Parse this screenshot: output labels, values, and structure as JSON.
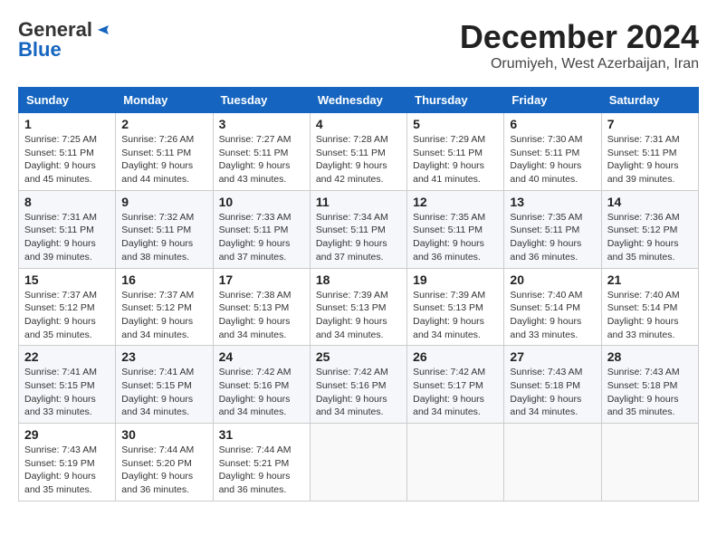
{
  "header": {
    "logo_general": "General",
    "logo_blue": "Blue",
    "title": "December 2024",
    "subtitle": "Orumiyeh, West Azerbaijan, Iran"
  },
  "weekdays": [
    "Sunday",
    "Monday",
    "Tuesday",
    "Wednesday",
    "Thursday",
    "Friday",
    "Saturday"
  ],
  "weeks": [
    [
      {
        "day": 1,
        "sunrise": "7:25 AM",
        "sunset": "5:11 PM",
        "daylight": "9 hours and 45 minutes."
      },
      {
        "day": 2,
        "sunrise": "7:26 AM",
        "sunset": "5:11 PM",
        "daylight": "9 hours and 44 minutes."
      },
      {
        "day": 3,
        "sunrise": "7:27 AM",
        "sunset": "5:11 PM",
        "daylight": "9 hours and 43 minutes."
      },
      {
        "day": 4,
        "sunrise": "7:28 AM",
        "sunset": "5:11 PM",
        "daylight": "9 hours and 42 minutes."
      },
      {
        "day": 5,
        "sunrise": "7:29 AM",
        "sunset": "5:11 PM",
        "daylight": "9 hours and 41 minutes."
      },
      {
        "day": 6,
        "sunrise": "7:30 AM",
        "sunset": "5:11 PM",
        "daylight": "9 hours and 40 minutes."
      },
      {
        "day": 7,
        "sunrise": "7:31 AM",
        "sunset": "5:11 PM",
        "daylight": "9 hours and 39 minutes."
      }
    ],
    [
      {
        "day": 8,
        "sunrise": "7:31 AM",
        "sunset": "5:11 PM",
        "daylight": "9 hours and 39 minutes."
      },
      {
        "day": 9,
        "sunrise": "7:32 AM",
        "sunset": "5:11 PM",
        "daylight": "9 hours and 38 minutes."
      },
      {
        "day": 10,
        "sunrise": "7:33 AM",
        "sunset": "5:11 PM",
        "daylight": "9 hours and 37 minutes."
      },
      {
        "day": 11,
        "sunrise": "7:34 AM",
        "sunset": "5:11 PM",
        "daylight": "9 hours and 37 minutes."
      },
      {
        "day": 12,
        "sunrise": "7:35 AM",
        "sunset": "5:11 PM",
        "daylight": "9 hours and 36 minutes."
      },
      {
        "day": 13,
        "sunrise": "7:35 AM",
        "sunset": "5:11 PM",
        "daylight": "9 hours and 36 minutes."
      },
      {
        "day": 14,
        "sunrise": "7:36 AM",
        "sunset": "5:12 PM",
        "daylight": "9 hours and 35 minutes."
      }
    ],
    [
      {
        "day": 15,
        "sunrise": "7:37 AM",
        "sunset": "5:12 PM",
        "daylight": "9 hours and 35 minutes."
      },
      {
        "day": 16,
        "sunrise": "7:37 AM",
        "sunset": "5:12 PM",
        "daylight": "9 hours and 34 minutes."
      },
      {
        "day": 17,
        "sunrise": "7:38 AM",
        "sunset": "5:13 PM",
        "daylight": "9 hours and 34 minutes."
      },
      {
        "day": 18,
        "sunrise": "7:39 AM",
        "sunset": "5:13 PM",
        "daylight": "9 hours and 34 minutes."
      },
      {
        "day": 19,
        "sunrise": "7:39 AM",
        "sunset": "5:13 PM",
        "daylight": "9 hours and 34 minutes."
      },
      {
        "day": 20,
        "sunrise": "7:40 AM",
        "sunset": "5:14 PM",
        "daylight": "9 hours and 33 minutes."
      },
      {
        "day": 21,
        "sunrise": "7:40 AM",
        "sunset": "5:14 PM",
        "daylight": "9 hours and 33 minutes."
      }
    ],
    [
      {
        "day": 22,
        "sunrise": "7:41 AM",
        "sunset": "5:15 PM",
        "daylight": "9 hours and 33 minutes."
      },
      {
        "day": 23,
        "sunrise": "7:41 AM",
        "sunset": "5:15 PM",
        "daylight": "9 hours and 34 minutes."
      },
      {
        "day": 24,
        "sunrise": "7:42 AM",
        "sunset": "5:16 PM",
        "daylight": "9 hours and 34 minutes."
      },
      {
        "day": 25,
        "sunrise": "7:42 AM",
        "sunset": "5:16 PM",
        "daylight": "9 hours and 34 minutes."
      },
      {
        "day": 26,
        "sunrise": "7:42 AM",
        "sunset": "5:17 PM",
        "daylight": "9 hours and 34 minutes."
      },
      {
        "day": 27,
        "sunrise": "7:43 AM",
        "sunset": "5:18 PM",
        "daylight": "9 hours and 34 minutes."
      },
      {
        "day": 28,
        "sunrise": "7:43 AM",
        "sunset": "5:18 PM",
        "daylight": "9 hours and 35 minutes."
      }
    ],
    [
      {
        "day": 29,
        "sunrise": "7:43 AM",
        "sunset": "5:19 PM",
        "daylight": "9 hours and 35 minutes."
      },
      {
        "day": 30,
        "sunrise": "7:44 AM",
        "sunset": "5:20 PM",
        "daylight": "9 hours and 36 minutes."
      },
      {
        "day": 31,
        "sunrise": "7:44 AM",
        "sunset": "5:21 PM",
        "daylight": "9 hours and 36 minutes."
      },
      null,
      null,
      null,
      null
    ]
  ]
}
